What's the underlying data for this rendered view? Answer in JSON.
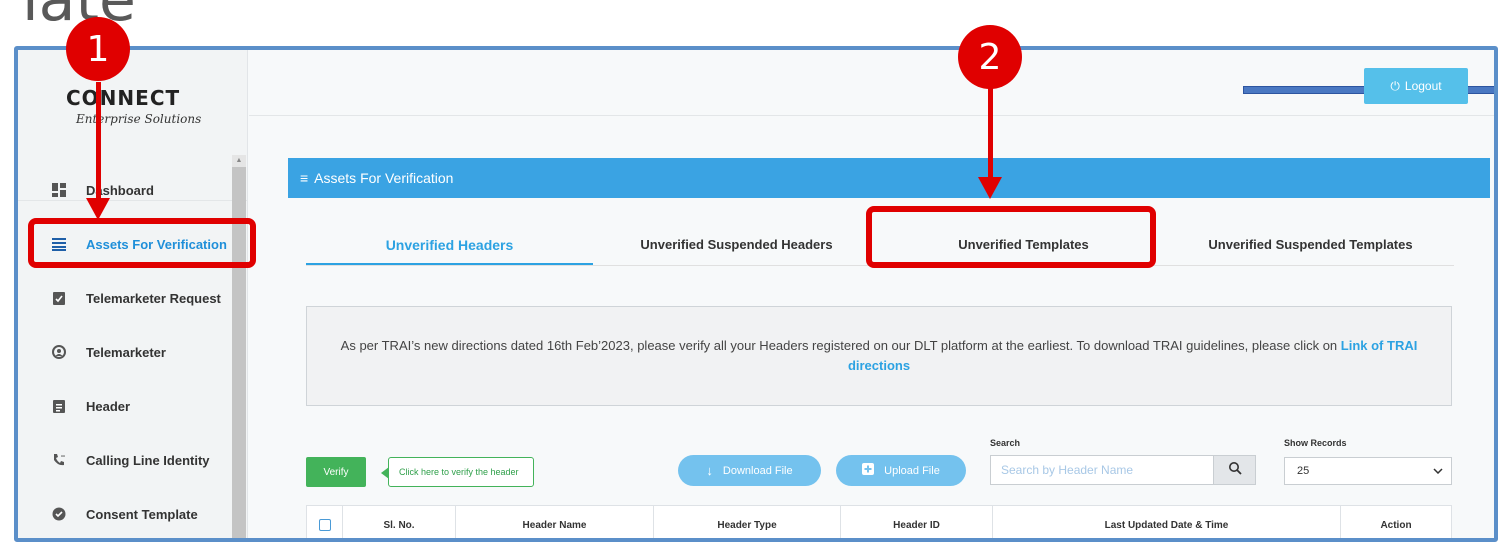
{
  "slide": {
    "title": "late"
  },
  "logo": {
    "main": "CONNECT",
    "sub": "Enterprise Solutions"
  },
  "sidebar": {
    "items": [
      {
        "label": "Dashboard",
        "icon": "dashboard-icon"
      },
      {
        "label": "Assets For Verification",
        "icon": "list-icon",
        "active": true
      },
      {
        "label": "Telemarketer Request",
        "icon": "clipboard-check-icon"
      },
      {
        "label": "Telemarketer",
        "icon": "user-circle-icon"
      },
      {
        "label": "Header",
        "icon": "clipboard-icon"
      },
      {
        "label": "Calling Line Identity",
        "icon": "phone-icon"
      },
      {
        "label": "Consent Template",
        "icon": "check-circle-icon"
      }
    ]
  },
  "topbar": {
    "logout_label": "Logout"
  },
  "panel": {
    "title": "Assets For Verification"
  },
  "tabs": [
    {
      "label": "Unverified Headers",
      "active": true
    },
    {
      "label": "Unverified Suspended Headers"
    },
    {
      "label": "Unverified Templates"
    },
    {
      "label": "Unverified Suspended Templates"
    }
  ],
  "notice": {
    "text": "As per TRAI’s new directions dated 16th Feb’2023, please verify all your Headers registered on our DLT platform at the earliest. To download TRAI guidelines, please click on ",
    "link": "Link of TRAI directions"
  },
  "actions": {
    "verify_label": "Verify",
    "verify_tip": "Click here to verify the header",
    "download_label": "Download File",
    "upload_label": "Upload File"
  },
  "search": {
    "label": "Search",
    "placeholder": "Search by Header Name"
  },
  "records": {
    "label": "Show Records",
    "value": "25"
  },
  "table": {
    "columns": [
      "Sl. No.",
      "Header Name",
      "Header Type",
      "Header ID",
      "Last Updated Date & Time",
      "Action"
    ]
  },
  "callouts": [
    "1",
    "2"
  ],
  "colors": {
    "accent": "#3aa3e3",
    "highlight": "#e00000",
    "verify": "#43b35a"
  }
}
